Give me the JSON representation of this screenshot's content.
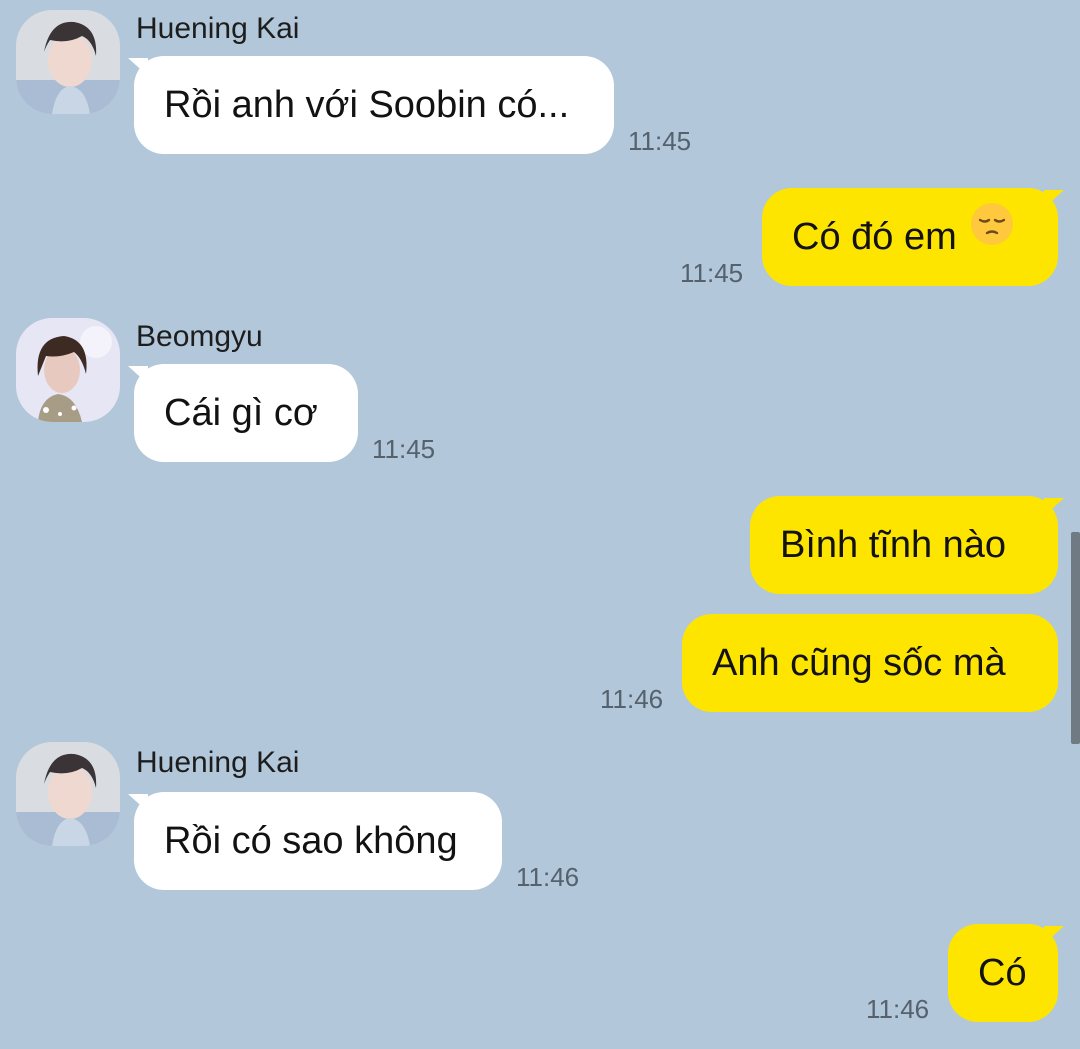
{
  "colors": {
    "background": "#b2c7d9",
    "incoming_bubble": "#ffffff",
    "outgoing_bubble": "#fee500",
    "timestamp": "#55626e"
  },
  "messages": [
    {
      "sender": "Huening Kai",
      "text": "Rồi anh với Soobin có...",
      "time": "11:45",
      "direction": "in"
    },
    {
      "text": "Có đó em",
      "emoji": "pensive-face-icon",
      "time": "11:45",
      "direction": "out"
    },
    {
      "sender": "Beomgyu",
      "text": "Cái gì cơ",
      "time": "11:45",
      "direction": "in"
    },
    {
      "text": "Bình tĩnh nào",
      "direction": "out"
    },
    {
      "text": "Anh cũng sốc mà",
      "time": "11:46",
      "direction": "out"
    },
    {
      "sender": "Huening Kai",
      "text": "Rồi có sao không",
      "time": "11:46",
      "direction": "in"
    },
    {
      "text": "Có",
      "time": "11:46",
      "direction": "out"
    }
  ]
}
